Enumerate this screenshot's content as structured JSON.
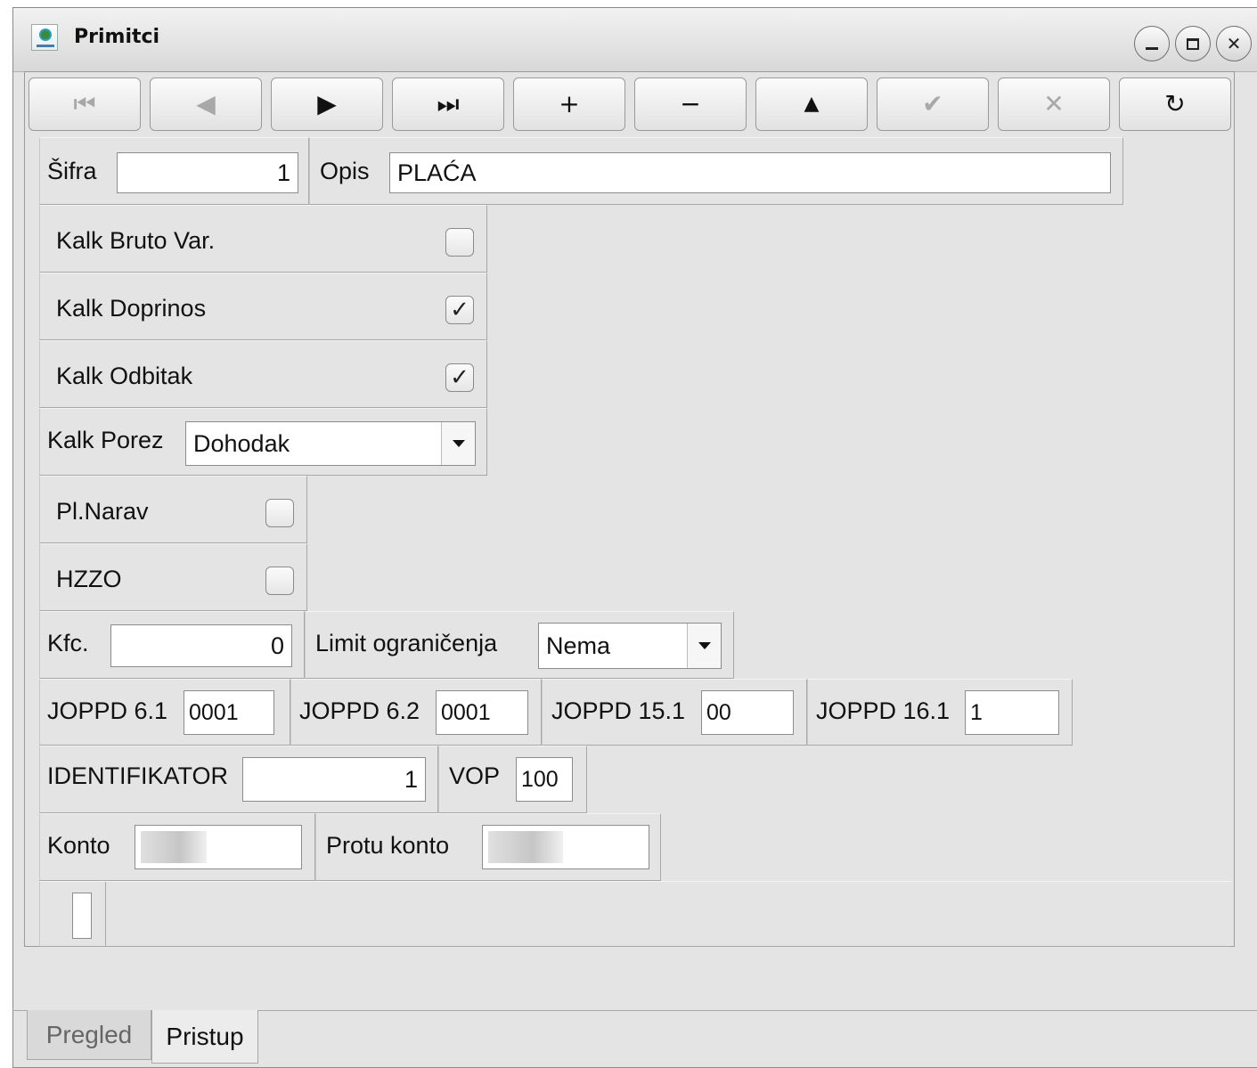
{
  "window": {
    "title": "Primitci",
    "controls": {
      "minimize": "minimize",
      "maximize": "maximize",
      "close": "close"
    }
  },
  "toolbar": [
    {
      "name": "first-record-button",
      "symbol": "⏮",
      "enabled": false
    },
    {
      "name": "previous-record-button",
      "symbol": "◀",
      "enabled": false
    },
    {
      "name": "next-record-button",
      "symbol": "▶",
      "enabled": true
    },
    {
      "name": "last-record-button",
      "symbol": "⏭",
      "enabled": true
    },
    {
      "name": "add-record-button",
      "symbol": "+",
      "enabled": true
    },
    {
      "name": "delete-record-button",
      "symbol": "−",
      "enabled": true
    },
    {
      "name": "edit-record-button",
      "symbol": "▲",
      "enabled": true
    },
    {
      "name": "confirm-button",
      "symbol": "✔",
      "enabled": false
    },
    {
      "name": "cancel-button",
      "symbol": "✕",
      "enabled": false
    },
    {
      "name": "refresh-button",
      "symbol": "↻",
      "enabled": true
    }
  ],
  "form": {
    "sifra": {
      "label": "Šifra",
      "value": "1"
    },
    "opis": {
      "label": "Opis",
      "value": "PLAĆA"
    },
    "kalk_bruto_var": {
      "label": "Kalk Bruto Var.",
      "checked": false
    },
    "kalk_doprinos": {
      "label": "Kalk Doprinos",
      "checked": true
    },
    "kalk_odbitak": {
      "label": "Kalk Odbitak",
      "checked": true
    },
    "kalk_porez": {
      "label": "Kalk Porez",
      "value": "Dohodak"
    },
    "pl_narav": {
      "label": "Pl.Narav",
      "checked": false
    },
    "hzzo": {
      "label": "HZZO",
      "checked": false
    },
    "kfc": {
      "label": "Kfc.",
      "value": "0"
    },
    "limit": {
      "label": "Limit ograničenja",
      "value": "Nema"
    },
    "joppd_61": {
      "label": "JOPPD 6.1",
      "value": "0001"
    },
    "joppd_62": {
      "label": "JOPPD 6.2",
      "value": "0001"
    },
    "joppd_151": {
      "label": "JOPPD 15.1",
      "value": "00"
    },
    "joppd_161": {
      "label": "JOPPD 16.1",
      "value": "1"
    },
    "identifikator": {
      "label": "IDENTIFIKATOR",
      "value": "1"
    },
    "vop": {
      "label": "VOP",
      "value": "100"
    },
    "konto": {
      "label": "Konto"
    },
    "protu_konto": {
      "label": "Protu konto"
    }
  },
  "tabs": [
    {
      "label": "Pregled",
      "active": false
    },
    {
      "label": "Pristup",
      "active": true
    }
  ],
  "check_mark": "✓"
}
